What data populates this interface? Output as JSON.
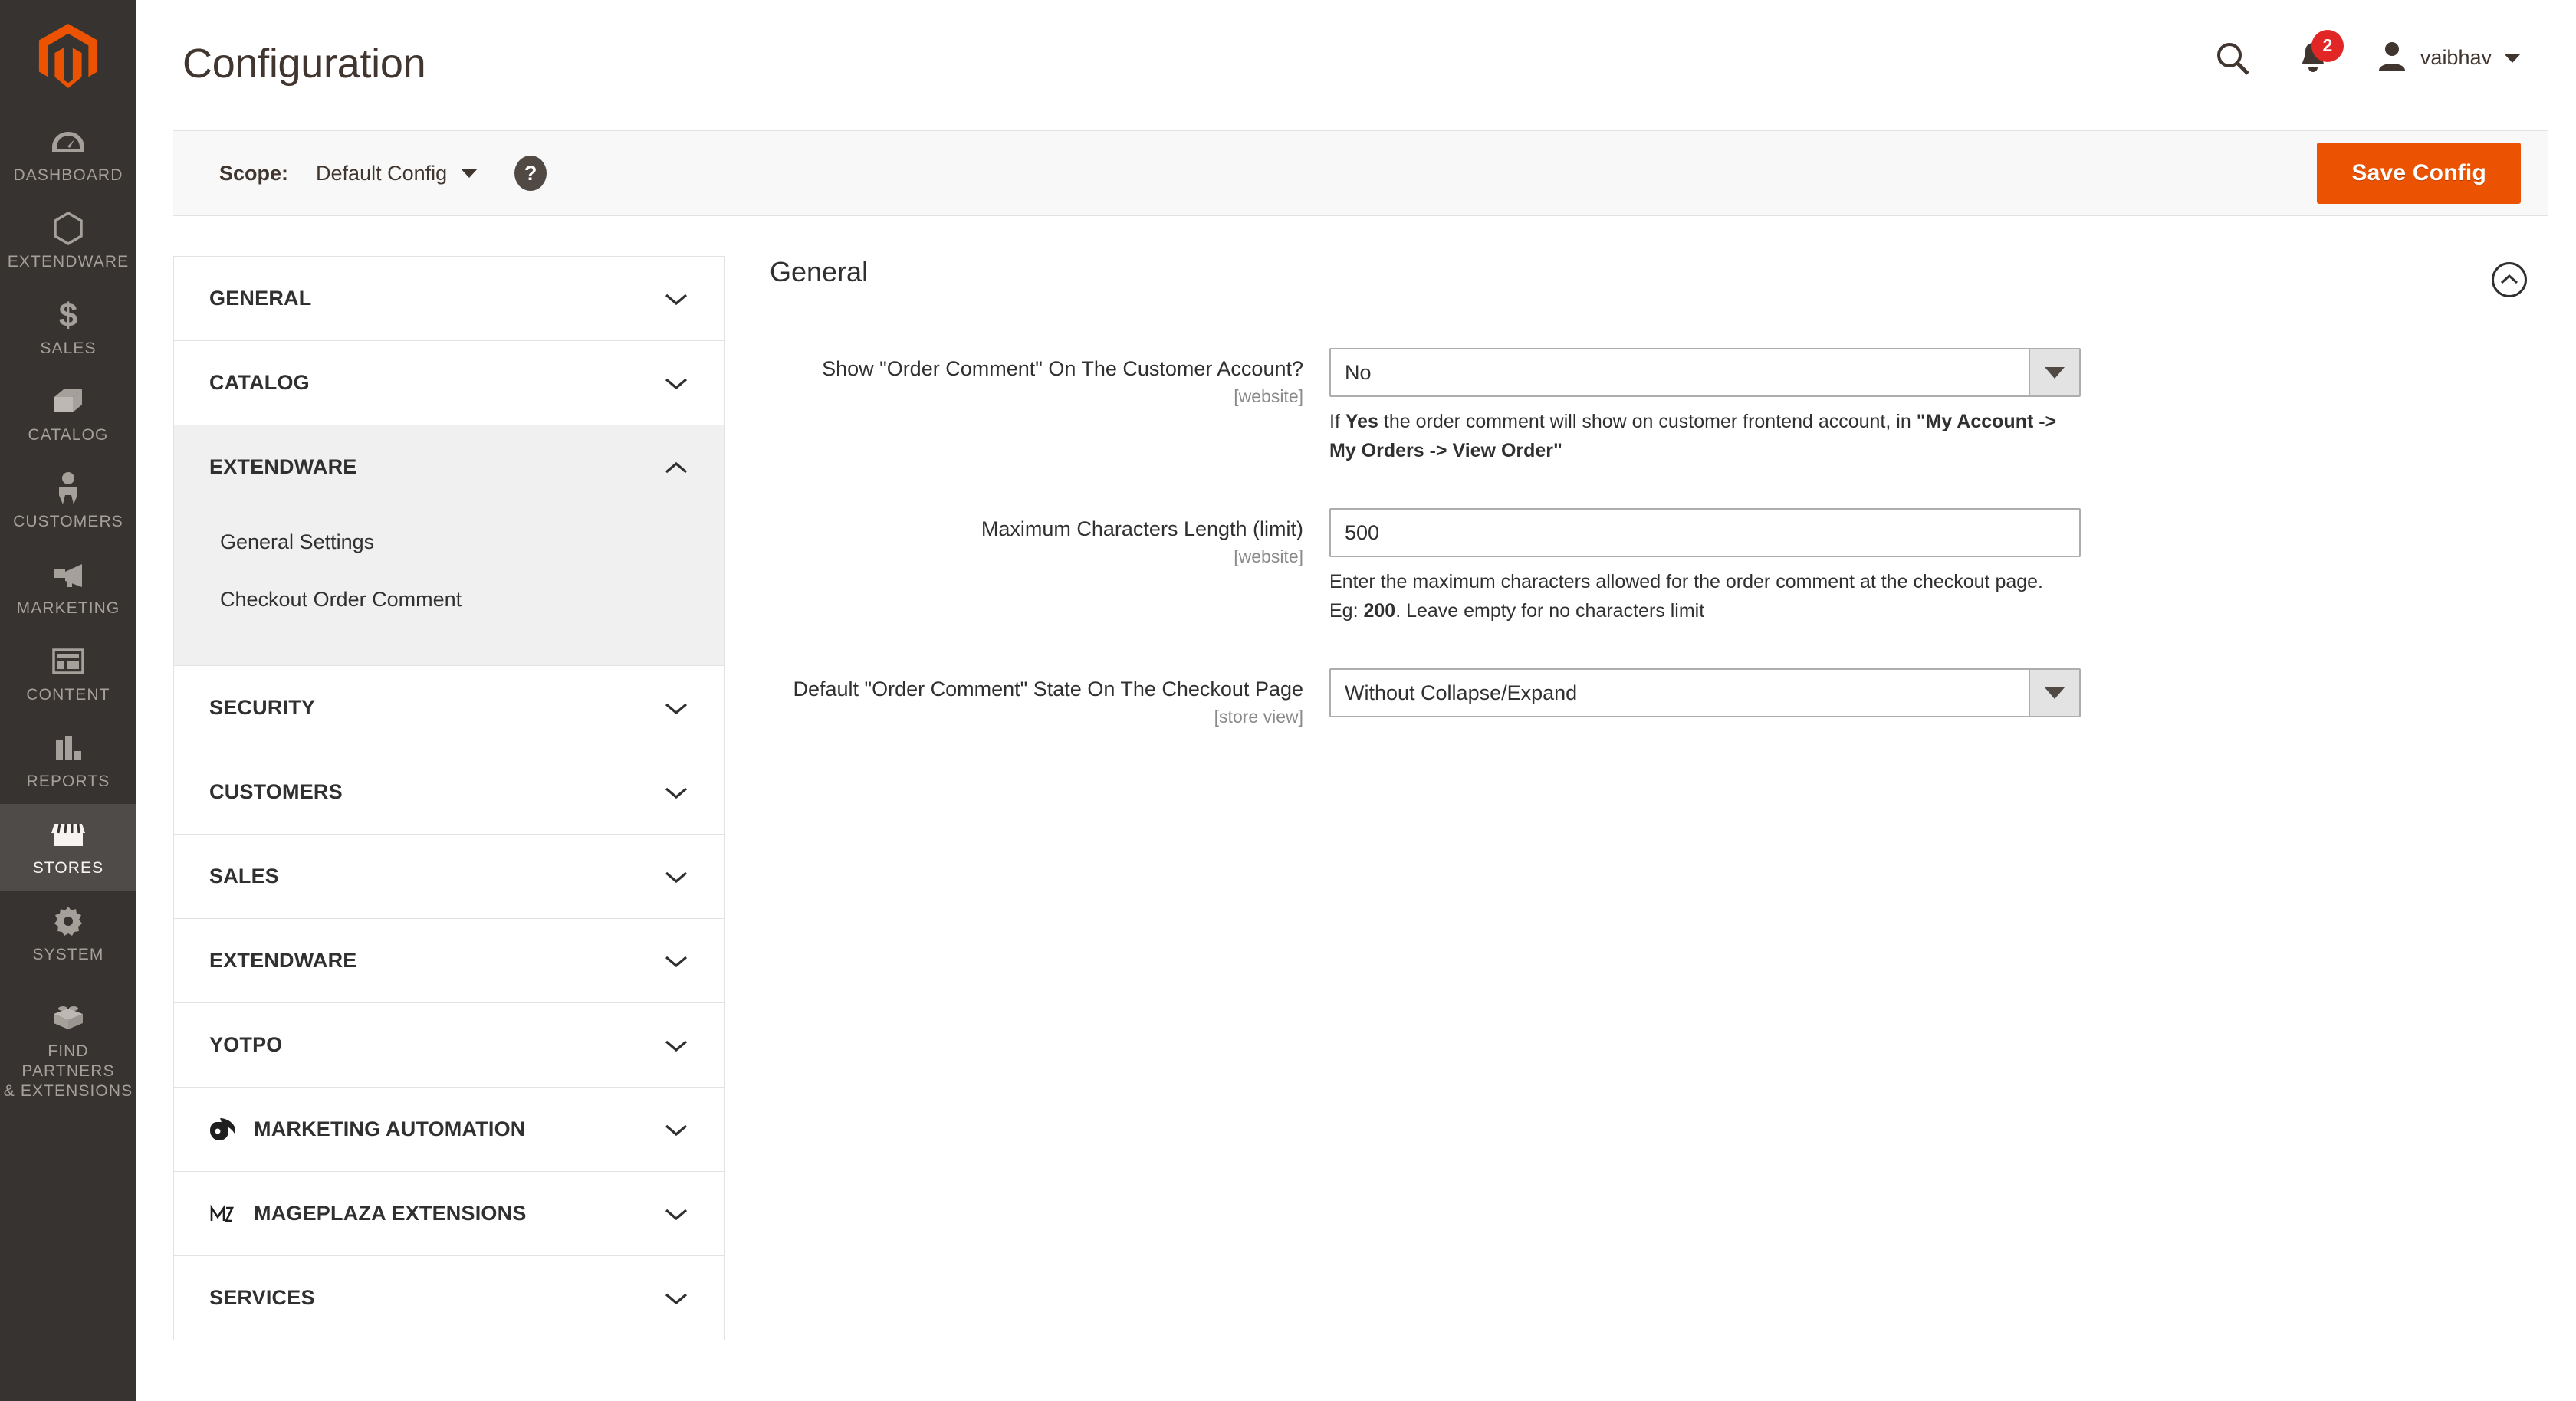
{
  "brand": {
    "logo_color": "#eb5202",
    "sidebar_bg": "#373330",
    "accent": "#eb5202"
  },
  "sidebar": {
    "logo_name": "magento-logo-icon",
    "items": [
      {
        "label": "DASHBOARD",
        "icon": "dashboard-icon",
        "active": false
      },
      {
        "label": "EXTENDWARE",
        "icon": "hexagon-icon",
        "active": false
      },
      {
        "label": "SALES",
        "icon": "dollar-icon",
        "active": false
      },
      {
        "label": "CATALOG",
        "icon": "box-icon",
        "active": false
      },
      {
        "label": "CUSTOMERS",
        "icon": "person-icon",
        "active": false
      },
      {
        "label": "MARKETING",
        "icon": "megaphone-icon",
        "active": false
      },
      {
        "label": "CONTENT",
        "icon": "layout-icon",
        "active": false
      },
      {
        "label": "REPORTS",
        "icon": "bar-chart-icon",
        "active": false
      },
      {
        "label": "STORES",
        "icon": "storefront-icon",
        "active": true
      },
      {
        "label": "SYSTEM",
        "icon": "gear-icon",
        "active": false
      },
      {
        "label": "FIND PARTNERS\n& EXTENSIONS",
        "icon": "brick-icon",
        "active": false
      }
    ]
  },
  "header": {
    "title": "Configuration",
    "search_icon": "search-icon",
    "notifications_icon": "bell-icon",
    "notifications_count": "2",
    "user_icon": "avatar-icon",
    "user_name": "vaibhav"
  },
  "page_actions": {
    "scope_label": "Scope:",
    "scope_value": "Default Config",
    "help_glyph": "?",
    "save_label": "Save Config"
  },
  "config_nav": {
    "sections": [
      {
        "label": "GENERAL",
        "state": "collapsed",
        "icon": null,
        "children": []
      },
      {
        "label": "CATALOG",
        "state": "collapsed",
        "icon": null,
        "children": []
      },
      {
        "label": "EXTENDWARE",
        "state": "expanded",
        "icon": null,
        "children": [
          {
            "label": "General Settings",
            "selected": false
          },
          {
            "label": "Checkout Order Comment",
            "selected": true
          }
        ]
      },
      {
        "label": "SECURITY",
        "state": "collapsed",
        "icon": null,
        "children": []
      },
      {
        "label": "CUSTOMERS",
        "state": "collapsed",
        "icon": null,
        "children": []
      },
      {
        "label": "SALES",
        "state": "collapsed",
        "icon": null,
        "children": []
      },
      {
        "label": "EXTENDWARE",
        "state": "collapsed",
        "icon": null,
        "children": []
      },
      {
        "label": "YOTPO",
        "state": "collapsed",
        "icon": null,
        "children": []
      },
      {
        "label": "MARKETING AUTOMATION",
        "state": "collapsed",
        "icon": "dotdigital-logo-icon",
        "children": []
      },
      {
        "label": "MAGEPLAZA EXTENSIONS",
        "state": "collapsed",
        "icon": "mageplaza-logo-icon",
        "children": []
      },
      {
        "label": "SERVICES",
        "state": "collapsed",
        "icon": null,
        "children": []
      }
    ]
  },
  "main": {
    "section_title": "General",
    "collapse_icon": "chevron-up-circle-icon",
    "fields": [
      {
        "label": "Show \"Order Comment\" On The Customer Account?",
        "scope": "[website]",
        "control": "select",
        "value": "No",
        "note_html": "If <b>Yes</b> the order comment will show on customer frontend account, in <b>\"My Account -&gt; My Orders -&gt; View Order\"</b>"
      },
      {
        "label": "Maximum Characters Length (limit)",
        "scope": "[website]",
        "control": "text",
        "value": "500",
        "note_html": "Enter the maximum characters allowed for the order comment at the checkout page.<br>Eg: <b>200</b>. Leave empty for no characters limit"
      },
      {
        "label": "Default \"Order Comment\" State On The Checkout Page",
        "scope": "[store view]",
        "control": "select",
        "value": "Without Collapse/Expand",
        "note_html": ""
      }
    ]
  }
}
